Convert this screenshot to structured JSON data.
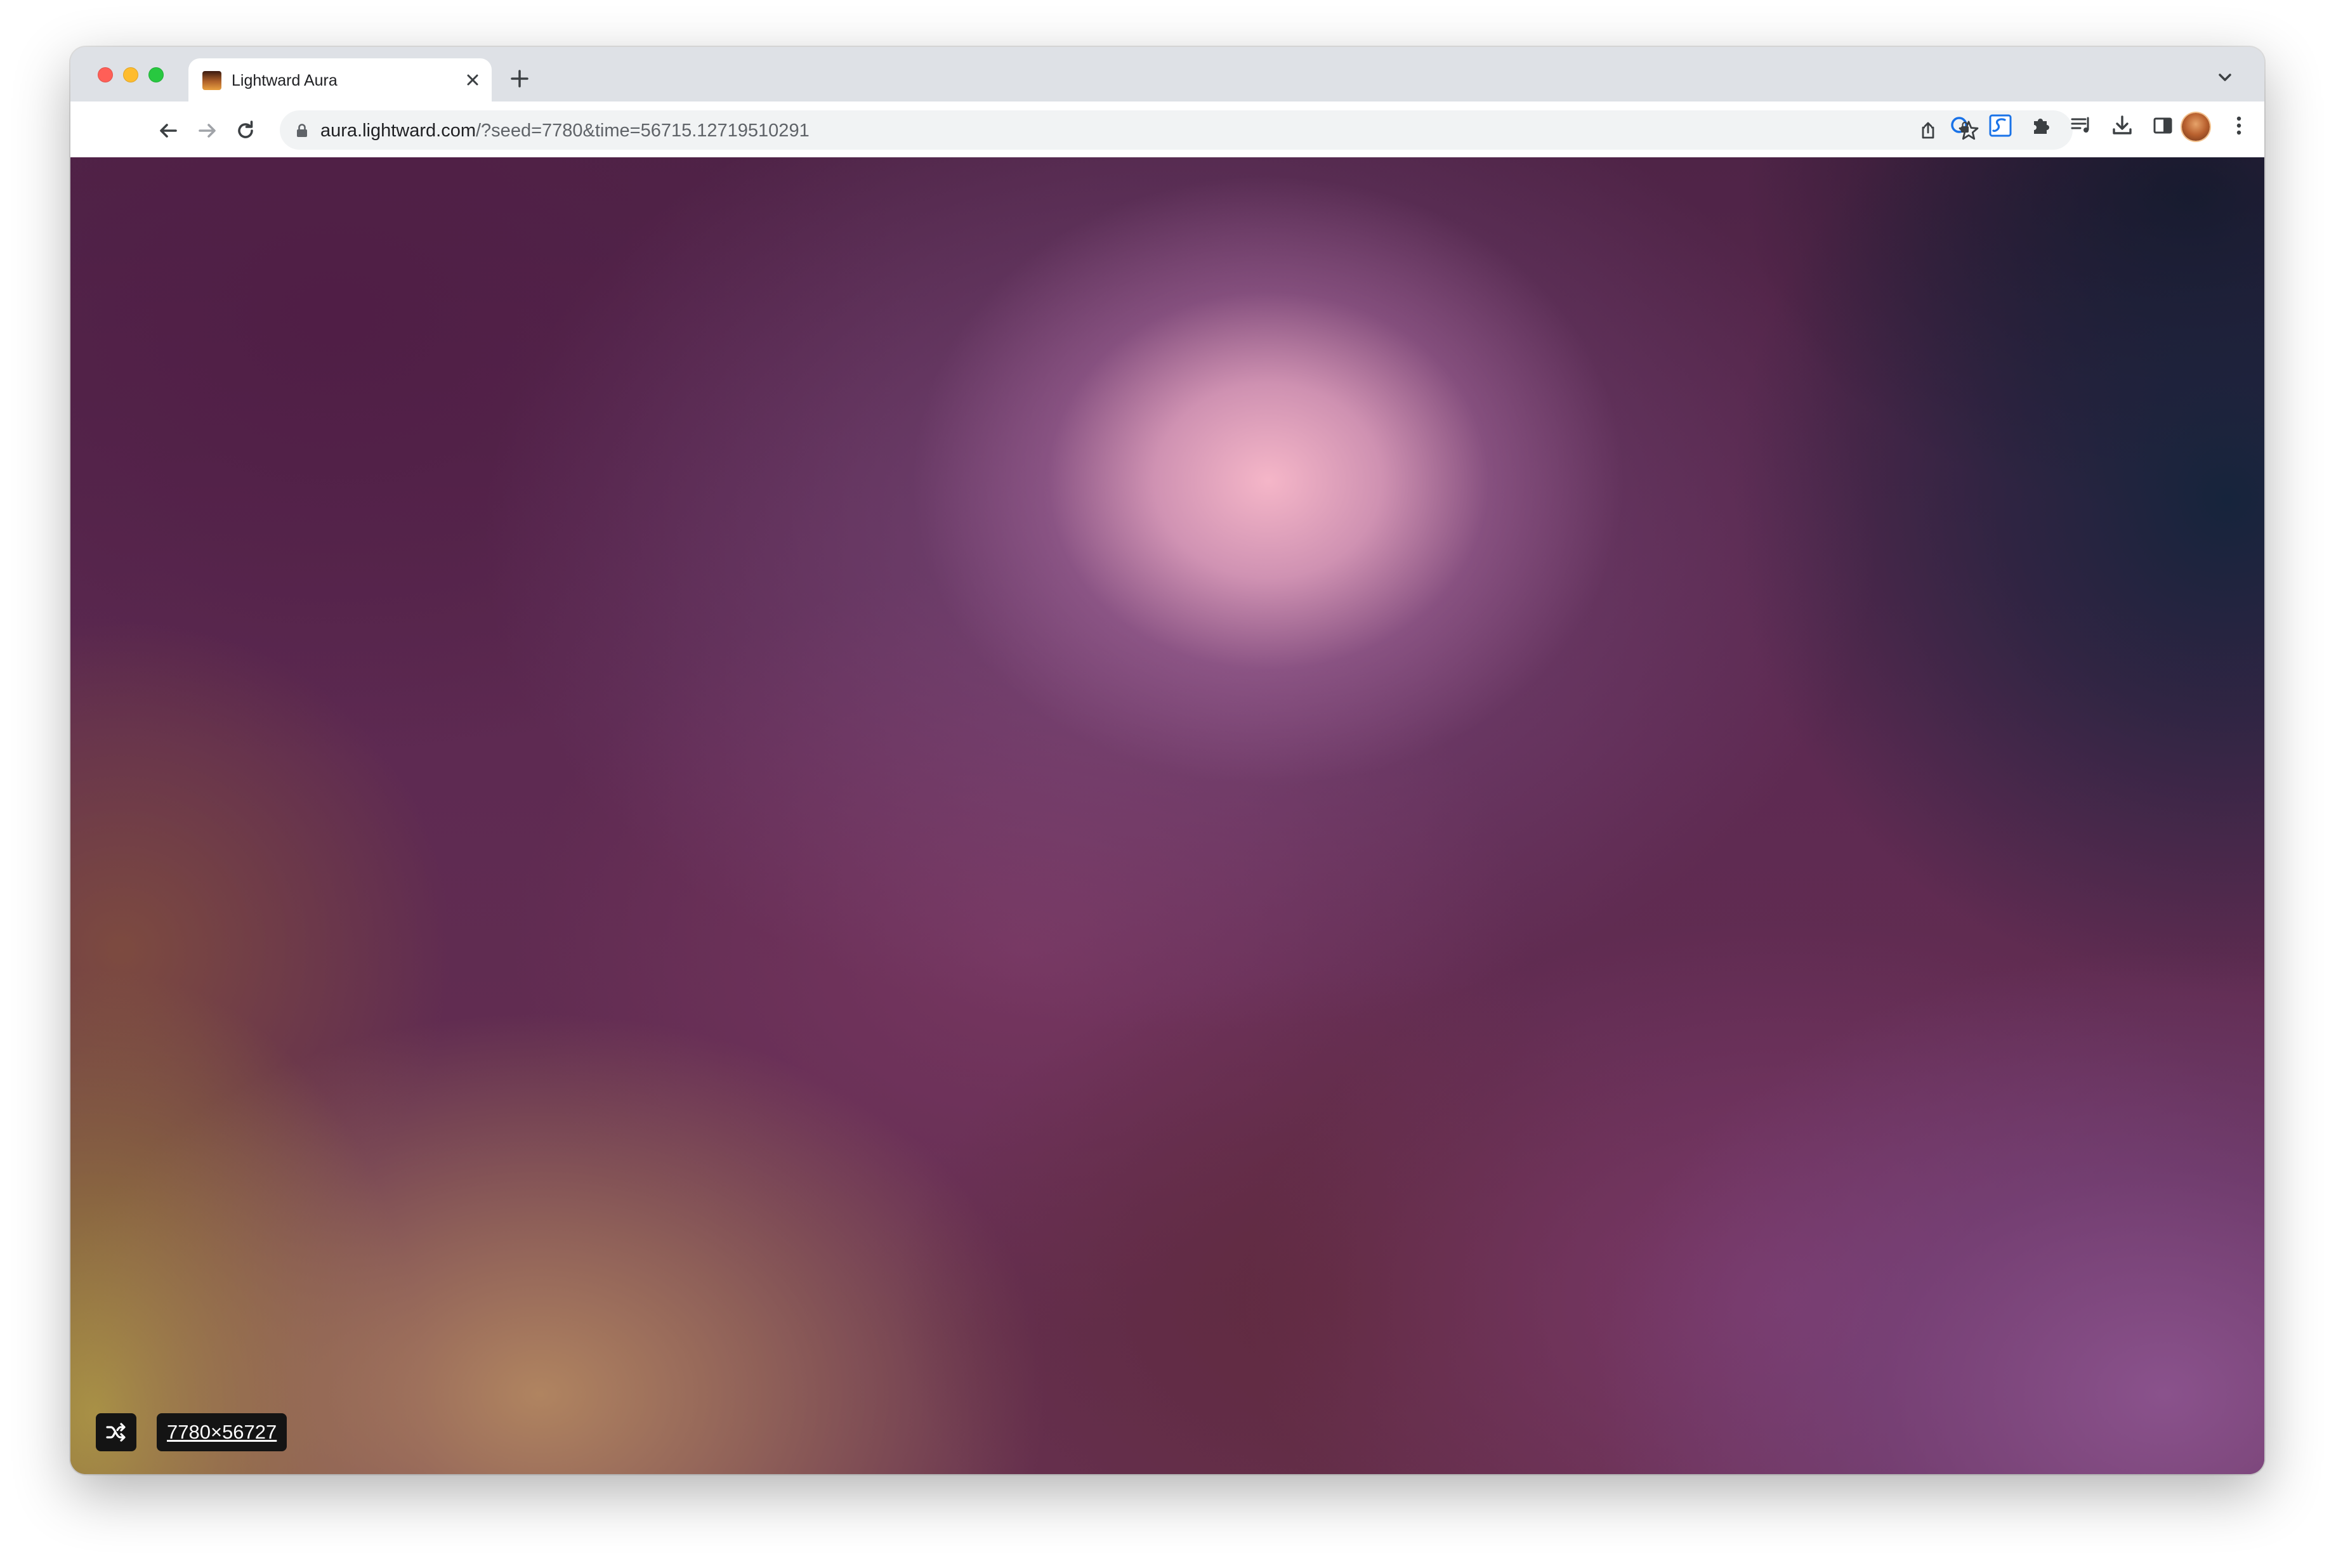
{
  "browser": {
    "tab": {
      "title": "Lightward Aura"
    },
    "address_bar": {
      "domain": "aura.lightward.com",
      "path": "/?seed=7780&time=56715.12719510291"
    }
  },
  "page": {
    "seed_label": "7780×56727"
  },
  "colors": {
    "control_bg": "#141414",
    "control_text": "#ffffff"
  },
  "icons": {
    "shuffle": "shuffle-icon",
    "back": "back-arrow-icon",
    "forward": "forward-arrow-icon",
    "reload": "reload-icon",
    "lock": "lock-icon",
    "share": "share-icon",
    "bookmark": "star-icon",
    "extensions": "puzzle-icon",
    "downloads": "download-icon",
    "side_panel": "side-panel-icon",
    "menu": "kebab-menu-icon"
  }
}
